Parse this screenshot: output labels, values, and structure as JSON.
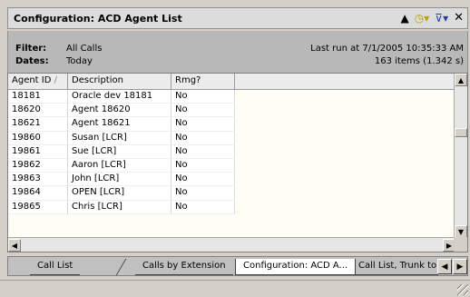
{
  "window": {
    "title": "Configuration: ACD Agent List"
  },
  "filter": {
    "filter_label": "Filter:",
    "filter_value": "All Calls",
    "dates_label": "Dates:",
    "dates_value": "Today",
    "last_run": "Last run at 7/1/2005 10:35:33 AM",
    "item_count": "163 items (1.342 s)"
  },
  "icons": {
    "up": "up-arrow-icon",
    "clock": "clock-icon",
    "filter": "filter-icon",
    "close": "close-icon"
  },
  "table": {
    "columns": [
      "Agent ID",
      "Description",
      "Rmg?"
    ],
    "rows": [
      [
        "18181",
        "Oracle dev 18181",
        "No"
      ],
      [
        "18620",
        "Agent 18620",
        "No"
      ],
      [
        "18621",
        "Agent 18621",
        "No"
      ],
      [
        "19860",
        "Susan [LCR]",
        "No"
      ],
      [
        "19861",
        "Sue [LCR]",
        "No"
      ],
      [
        "19862",
        "Aaron [LCR]",
        "No"
      ],
      [
        "19863",
        "John [LCR]",
        "No"
      ],
      [
        "19864",
        "OPEN [LCR]",
        "No"
      ],
      [
        "19865",
        "Chris [LCR]",
        "No"
      ]
    ]
  },
  "tabs": [
    {
      "label": "Call List",
      "active": false
    },
    {
      "label": "Calls by Extension",
      "active": false
    },
    {
      "label": "Configuration: ACD A...",
      "active": true
    },
    {
      "label": "Call List, Trunk to",
      "active": false
    }
  ]
}
